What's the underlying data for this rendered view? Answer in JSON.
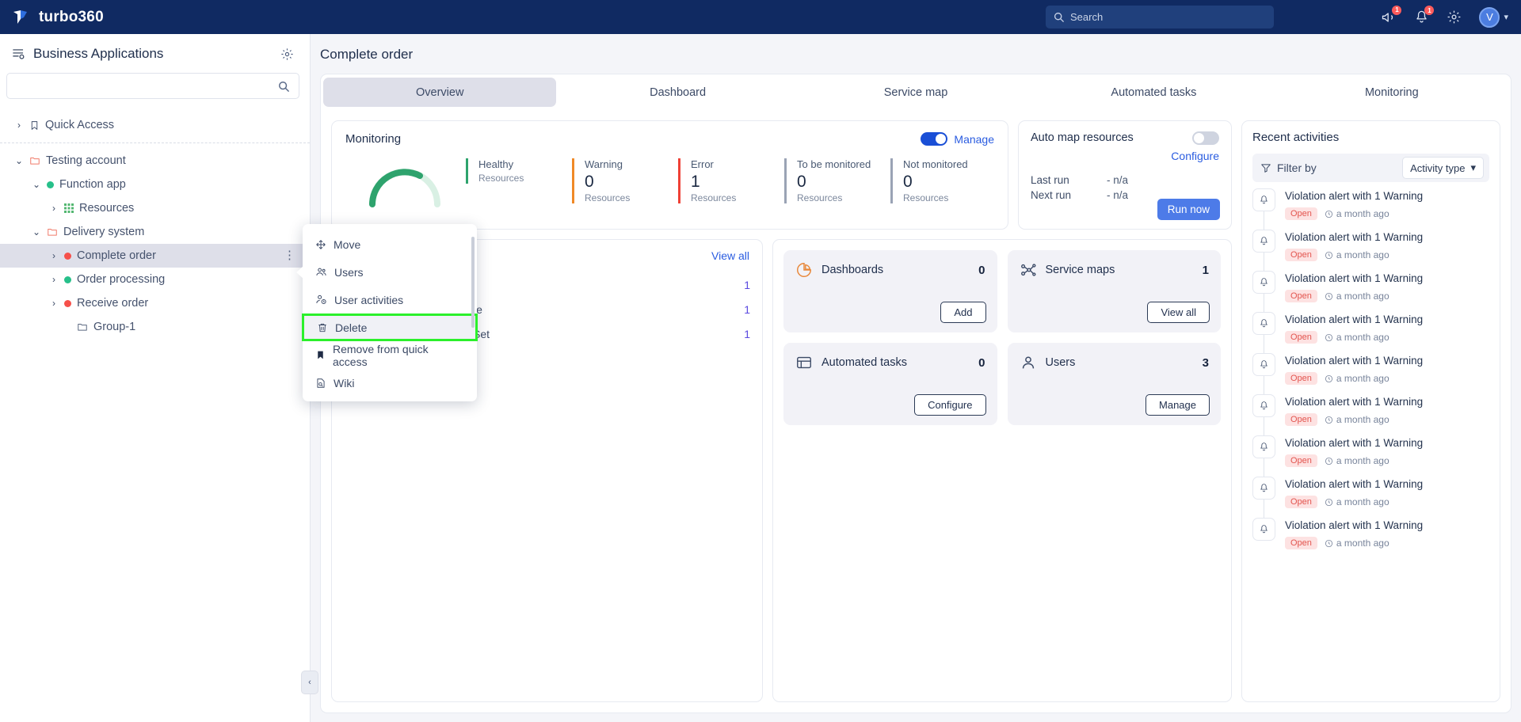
{
  "header": {
    "brand": "turbo360",
    "search_placeholder": "Search",
    "announce_badge": "1",
    "bell_badge": "1",
    "avatar_initial": "V"
  },
  "sidebar": {
    "title": "Business Applications",
    "search_value": "",
    "tree": [
      {
        "label": "Quick Access",
        "icon": "bookmark-icon",
        "chevron": "›",
        "indent": 0,
        "selected": false,
        "dot": null
      },
      {
        "label": "Testing account",
        "icon": "folder-icon",
        "chevron": "⌄",
        "indent": 0,
        "selected": false,
        "dot": null
      },
      {
        "label": "Function app",
        "icon": "status-dot",
        "chevron": "⌄",
        "indent": 1,
        "selected": false,
        "dot": "green"
      },
      {
        "label": "Resources",
        "icon": "grid-icon",
        "chevron": "›",
        "indent": 2,
        "selected": false,
        "dot": null
      },
      {
        "label": "Delivery system",
        "icon": "folder-icon",
        "chevron": "⌄",
        "indent": 1,
        "selected": false,
        "dot": null
      },
      {
        "label": "Complete order",
        "icon": "status-dot",
        "chevron": "›",
        "indent": 2,
        "selected": true,
        "dot": "red"
      },
      {
        "label": "Order processing",
        "icon": "status-dot",
        "chevron": "›",
        "indent": 2,
        "selected": false,
        "dot": "green"
      },
      {
        "label": "Receive order",
        "icon": "status-dot",
        "chevron": "›",
        "indent": 2,
        "selected": false,
        "dot": "red"
      },
      {
        "label": "Group-1",
        "icon": "folder-icon",
        "chevron": "",
        "indent": 3,
        "selected": false,
        "dot": null
      }
    ]
  },
  "context_menu": {
    "items": [
      {
        "label": "Move",
        "icon": "move-icon",
        "highlighted": false
      },
      {
        "label": "Users",
        "icon": "users-icon",
        "highlighted": false
      },
      {
        "label": "User activities",
        "icon": "user-activity-icon",
        "highlighted": false
      },
      {
        "label": "Delete",
        "icon": "trash-icon",
        "highlighted": true
      },
      {
        "label": "Remove from quick access",
        "icon": "bookmark-icon",
        "highlighted": false
      },
      {
        "label": "Wiki",
        "icon": "wiki-icon",
        "highlighted": false
      }
    ]
  },
  "main": {
    "page_title": "Complete order",
    "tabs": [
      {
        "label": "Overview",
        "active": true
      },
      {
        "label": "Dashboard",
        "active": false
      },
      {
        "label": "Service map",
        "active": false
      },
      {
        "label": "Automated tasks",
        "active": false
      },
      {
        "label": "Monitoring",
        "active": false
      }
    ],
    "monitoring": {
      "title": "Monitoring",
      "manage_label": "Manage",
      "toggle_on": true,
      "stats": [
        {
          "label": "Healthy",
          "value": "",
          "sub": "Resources",
          "color": "#2ea36d"
        },
        {
          "label": "Warning",
          "value": "0",
          "sub": "Resources",
          "color": "#f08927"
        },
        {
          "label": "Error",
          "value": "1",
          "sub": "Resources",
          "color": "#ef4136"
        },
        {
          "label": "To be monitored",
          "value": "0",
          "sub": "Resources",
          "color": "#9aa3b5"
        },
        {
          "label": "Not monitored",
          "value": "0",
          "sub": "Resources",
          "color": "#9aa3b5"
        }
      ]
    },
    "auto_map": {
      "title": "Auto map resources",
      "toggle_on": false,
      "configure_label": "Configure",
      "last_run_label": "Last run",
      "last_run_value": "- n/a",
      "next_run_label": "Next run",
      "next_run_value": "- n/a",
      "run_button": "Run now"
    },
    "resources": {
      "view_all": "View all",
      "items": [
        {
          "name": "Event Hubs Namespace",
          "count": "1",
          "icon": "eventhub-icon"
        },
        {
          "name": "Virtual Machine Scale Set",
          "count": "1",
          "icon": "vmss-icon"
        }
      ],
      "hidden_counts": [
        "1"
      ]
    },
    "tiles": [
      {
        "name": "Dashboards",
        "count": "0",
        "button": "Add",
        "icon": "pie-chart-icon"
      },
      {
        "name": "Service maps",
        "count": "1",
        "button": "View all",
        "icon": "service-map-icon"
      },
      {
        "name": "Automated tasks",
        "count": "0",
        "button": "Configure",
        "icon": "tasks-icon"
      },
      {
        "name": "Users",
        "count": "3",
        "button": "Manage",
        "icon": "user-icon"
      }
    ]
  },
  "activities": {
    "title": "Recent activities",
    "filter_label": "Filter by",
    "select_label": "Activity type",
    "items": [
      {
        "text": "Violation alert with 1 Warning",
        "status": "Open",
        "time": "a month ago"
      },
      {
        "text": "Violation alert with 1 Warning",
        "status": "Open",
        "time": "a month ago"
      },
      {
        "text": "Violation alert with 1 Warning",
        "status": "Open",
        "time": "a month ago"
      },
      {
        "text": "Violation alert with 1 Warning",
        "status": "Open",
        "time": "a month ago"
      },
      {
        "text": "Violation alert with 1 Warning",
        "status": "Open",
        "time": "a month ago"
      },
      {
        "text": "Violation alert with 1 Warning",
        "status": "Open",
        "time": "a month ago"
      },
      {
        "text": "Violation alert with 1 Warning",
        "status": "Open",
        "time": "a month ago"
      },
      {
        "text": "Violation alert with 1 Warning",
        "status": "Open",
        "time": "a month ago"
      },
      {
        "text": "Violation alert with 1 Warning",
        "status": "Open",
        "time": "a month ago"
      }
    ]
  }
}
